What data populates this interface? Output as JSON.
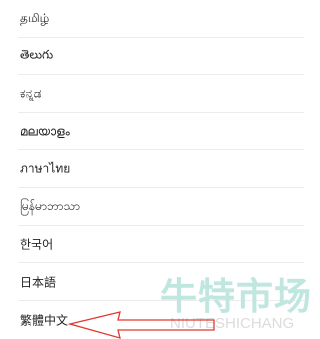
{
  "language_list": {
    "items": [
      {
        "label": "தமிழ்"
      },
      {
        "label": "తెలుగు"
      },
      {
        "label": "ಕನ್ನಡ"
      },
      {
        "label": "മലയാളം"
      },
      {
        "label": "ภาษาไทย"
      },
      {
        "label": "မြန်မာဘာသာ"
      },
      {
        "label": "한국어"
      },
      {
        "label": "日本語"
      },
      {
        "label": "繁體中文"
      }
    ]
  },
  "watermark": {
    "chinese": "牛特市场",
    "latin": "NIUTESHICHANG"
  },
  "colors": {
    "annotation_arrow": "#e0392f",
    "watermark_chinese": "#bfe6df",
    "divider": "#ececec"
  }
}
